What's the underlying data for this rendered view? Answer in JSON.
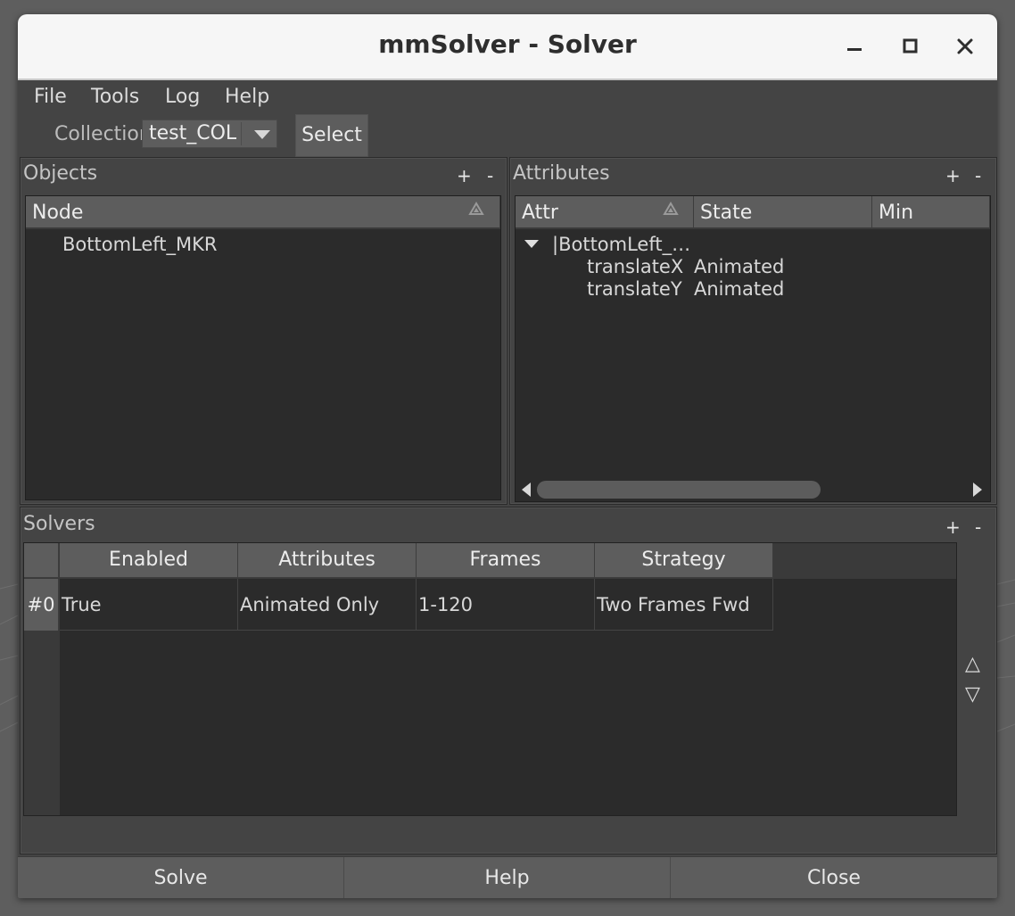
{
  "window": {
    "title": "mmSolver - Solver"
  },
  "menu": {
    "items": [
      "File",
      "Tools",
      "Log",
      "Help"
    ]
  },
  "collection": {
    "label": "Collection",
    "value": "test_COL",
    "select_label": "Select"
  },
  "objects": {
    "title": "Objects",
    "add_label": "+",
    "remove_label": "-",
    "header": "Node",
    "rows": [
      "BottomLeft_MKR"
    ]
  },
  "attributes": {
    "title": "Attributes",
    "add_label": "+",
    "remove_label": "-",
    "headers": [
      "Attr",
      "State",
      "Min"
    ],
    "parent_node": "|BottomLeft_…",
    "rows": [
      {
        "attr": "translateX",
        "state": "Animated"
      },
      {
        "attr": "translateY",
        "state": "Animated"
      }
    ]
  },
  "solvers": {
    "title": "Solvers",
    "add_label": "+",
    "remove_label": "-",
    "headers": [
      "Enabled",
      "Attributes",
      "Frames",
      "Strategy"
    ],
    "rows": [
      {
        "index": "#0",
        "enabled": "True",
        "attributes": "Animated Only",
        "frames": "1-120",
        "strategy": "Two Frames Fwd"
      }
    ],
    "move_up": "△",
    "move_down": "▽"
  },
  "footer": {
    "solve": "Solve",
    "help": "Help",
    "close": "Close"
  }
}
